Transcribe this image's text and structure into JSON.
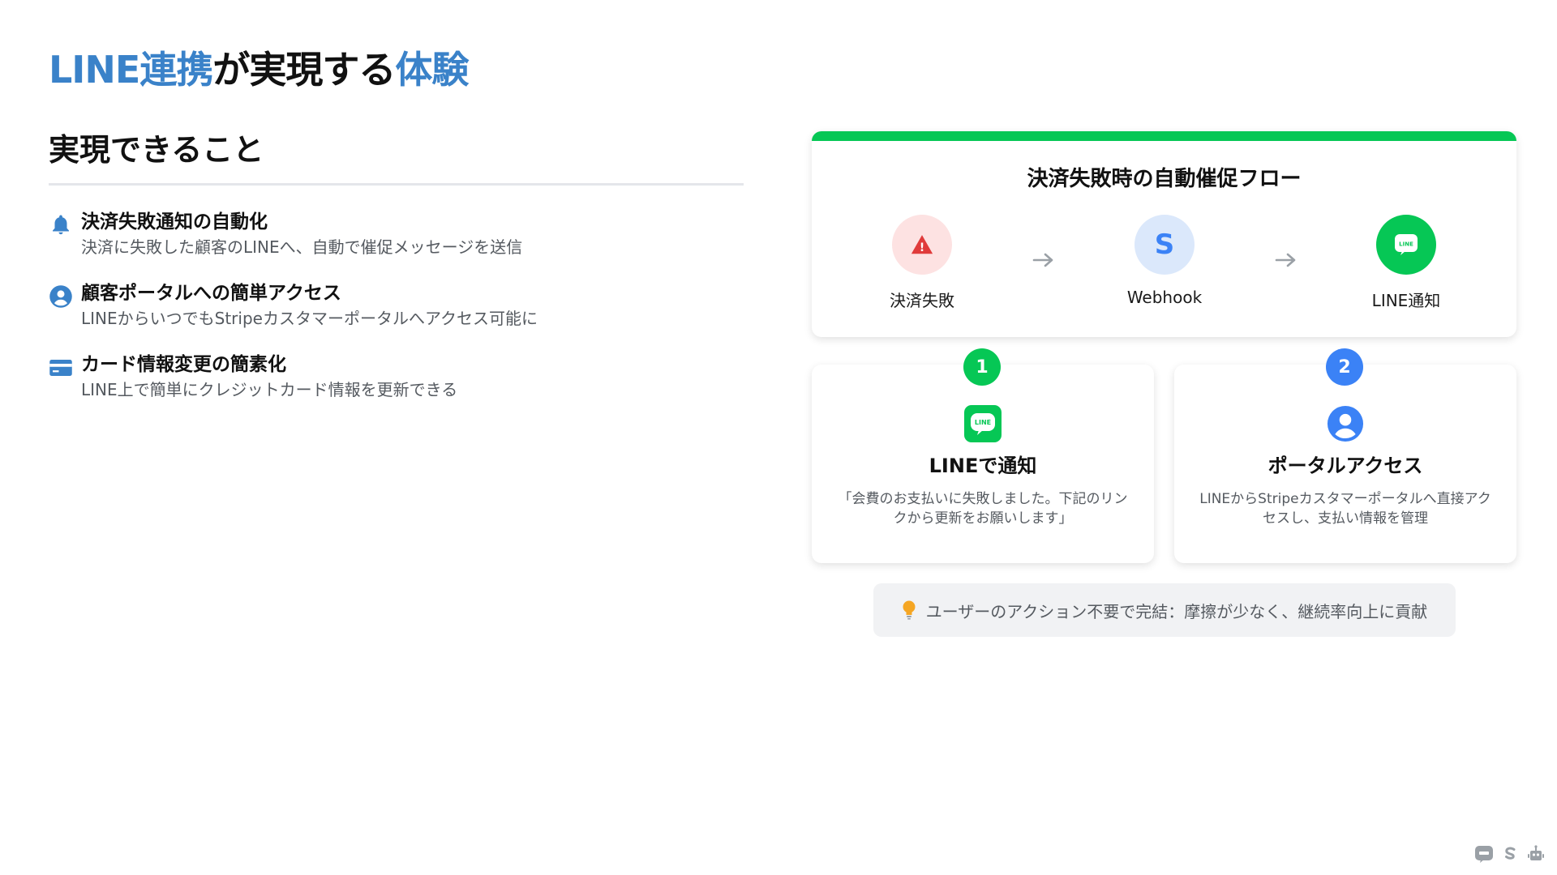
{
  "page": {
    "title_part1": "LINE連携",
    "title_part2": "が実現する",
    "title_part3": "体験",
    "accent_color": "#3a82c9"
  },
  "features": {
    "section_title": "実現できること",
    "items": [
      {
        "icon": "bell-icon",
        "title": "決済失敗通知の自動化",
        "desc": "決済に失敗した顧客のLINEへ、自動で催促メッセージを送信"
      },
      {
        "icon": "user-circle-icon",
        "title": "顧客ポータルへの簡単アクセス",
        "desc": "LINEからいつでもStripeカスタマーポータルへアクセス可能に"
      },
      {
        "icon": "credit-card-icon",
        "title": "カード情報変更の簡素化",
        "desc": "LINE上で簡単にクレジットカード情報を更新できる"
      }
    ]
  },
  "flow": {
    "title": "決済失敗時の自動催促フロー",
    "accent_color": "#06c755",
    "steps": [
      {
        "label": "決済失敗",
        "icon": "warning-icon",
        "icon_text": "!"
      },
      {
        "label": "Webhook",
        "icon": "stripe-s-icon",
        "icon_text": "S"
      },
      {
        "label": "LINE通知",
        "icon": "line-icon",
        "icon_text": "LINE"
      }
    ]
  },
  "steps": [
    {
      "number": "1",
      "icon": "line-icon",
      "icon_text": "LINE",
      "title": "LINEで通知",
      "desc": "「会費のお支払いに失敗しました。下記のリンクから更新をお願いします」",
      "badge_color": "#06c755"
    },
    {
      "number": "2",
      "icon": "user-circle-icon",
      "title": "ポータルアクセス",
      "desc": "LINEからStripeカスタマーポータルへ直接アクセスし、支払い情報を管理",
      "badge_color": "#3b82f6"
    }
  ],
  "tip": {
    "icon": "lightbulb-icon",
    "text": "ユーザーのアクション不要で完結：摩擦が少なく、継続率向上に貢献"
  },
  "footer_icons": [
    "line-icon",
    "stripe-s-icon",
    "robot-icon"
  ]
}
